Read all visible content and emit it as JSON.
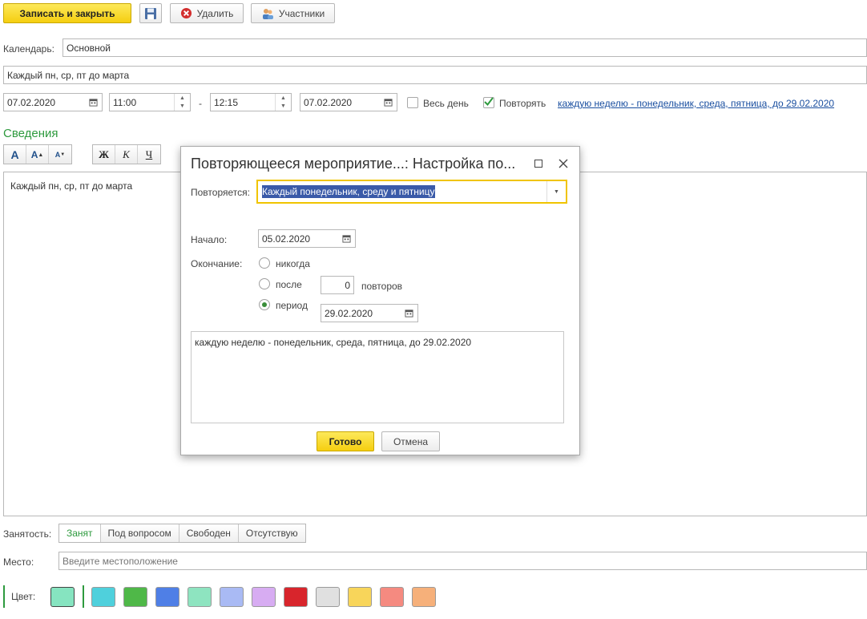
{
  "toolbar": {
    "save_close_label": "Записать и закрыть",
    "delete_label": "Удалить",
    "participants_label": "Участники"
  },
  "form": {
    "calendar_label": "Календарь:",
    "calendar_value": "Основной",
    "subject_value": "Каждый пн, ср, пт до марта",
    "start_date": "07.02.2020",
    "start_time": "11:00",
    "dash": "-",
    "end_time": "12:15",
    "end_date": "07.02.2020",
    "all_day_label": "Весь день",
    "repeat_label": "Повторять",
    "repeat_link": "каждую неделю - понедельник, среда, пятница, до 29.02.2020",
    "details_heading": "Сведения",
    "text_content": "Каждый пн, ср, пт до марта",
    "busy_label": "Занятость:",
    "busy_options": [
      "Занят",
      "Под вопросом",
      "Свободен",
      "Отсутствую"
    ],
    "place_label": "Место:",
    "place_placeholder": "Введите местоположение",
    "color_label": "Цвет:",
    "selected_color": "#86e4c0",
    "colors": [
      "#4fd0dc",
      "#4fb848",
      "#4f7fe6",
      "#8ee4c0",
      "#a9baf4",
      "#d7acf2",
      "#d8252c",
      "#e0e0e0",
      "#f8d55a",
      "#f58a80",
      "#f6b07a"
    ]
  },
  "format_toolbar": {
    "font_large": "A",
    "font_up": "A",
    "font_down": "A",
    "bold": "Ж",
    "italic": "К",
    "underline": "Ч"
  },
  "dialog": {
    "title": "Повторяющееся мероприятие...: Настройка по...",
    "repeats_label": "Повторяется:",
    "repeats_value": "Каждый понедельник, среду и пятницу",
    "start_label": "Начало:",
    "start_value": "05.02.2020",
    "end_label": "Окончание:",
    "never_label": "никогда",
    "after_label": "после",
    "after_value": "0",
    "repeats_suffix": "повторов",
    "period_label": "период",
    "period_value": "29.02.2020",
    "summary": "каждую неделю - понедельник, среда, пятница, до 29.02.2020",
    "ok_label": "Готово",
    "cancel_label": "Отмена"
  }
}
